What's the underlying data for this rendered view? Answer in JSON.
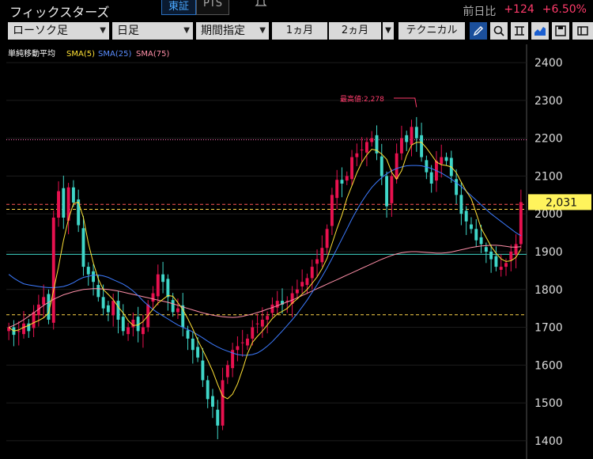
{
  "header": {
    "title": "フィックスターズ",
    "market_tabs": [
      "東証",
      "PTS"
    ],
    "change_label": "前日比",
    "change_value": "+124",
    "change_pct": "+6.50%"
  },
  "toolbar": {
    "chart_type": "ローソク足",
    "period": "日足",
    "range_mode": "期間指定",
    "range_1": "1ヵ月",
    "range_2": "2ヵ月",
    "technical": "テクニカル"
  },
  "colors": {
    "up": "#e8114f",
    "down": "#3fd6c8",
    "sma5": "#ffe135",
    "sma25": "#3d7bff",
    "sma75": "#ff8fa8",
    "price_label_bg": "#fff35c"
  },
  "chart_data": {
    "type": "candlestick",
    "indicator_label": "単純移動平均",
    "legend": [
      "SMA(5)",
      "SMA(25)",
      "SMA(75)"
    ],
    "y_ticks": [
      "2400",
      "2300",
      "2200",
      "2100",
      "2000",
      "1900",
      "1800",
      "1700",
      "1600",
      "1500",
      "1400"
    ],
    "ylim": [
      1360,
      2440
    ],
    "current_price": 2031,
    "current_price_label": "2,031",
    "annotation": "最高値:2,278",
    "annotation_value": 2278,
    "hlines": [
      {
        "value": 2196,
        "color": "#ff69b4",
        "style": "dotted"
      },
      {
        "value": 2025,
        "color": "#ff5555",
        "style": "dashed"
      },
      {
        "value": 2012,
        "color": "#ffd54a",
        "style": "dashed"
      },
      {
        "value": 1893,
        "color": "#3fd6c8",
        "style": "solid"
      },
      {
        "value": 1733,
        "color": "#ffd54a",
        "style": "dashed"
      }
    ],
    "close": [
      1700,
      1680,
      1690,
      1710,
      1690,
      1740,
      1760,
      1780,
      1720,
      1990,
      2060,
      1990,
      2070,
      2030,
      1970,
      1860,
      1840,
      1820,
      1780,
      1750,
      1740,
      1770,
      1720,
      1690,
      1700,
      1720,
      1690,
      1700,
      1760,
      1790,
      1840,
      1820,
      1780,
      1740,
      1750,
      1700,
      1670,
      1640,
      1620,
      1560,
      1510,
      1490,
      1440,
      1560,
      1600,
      1640,
      1650,
      1660,
      1670,
      1700,
      1710,
      1720,
      1730,
      1760,
      1770,
      1760,
      1770,
      1790,
      1800,
      1820,
      1830,
      1860,
      1880,
      1910,
      1960,
      2050,
      2090,
      2080,
      2100,
      2150,
      2160,
      2170,
      2190,
      2200,
      2160,
      2100,
      2020,
      2100,
      2160,
      2200,
      2190,
      2230,
      2200,
      2150,
      2110,
      2080,
      2140,
      2150,
      2140,
      2100,
      2050,
      2000,
      1980,
      1960,
      1930,
      1920,
      1900,
      1880,
      1860,
      1860,
      1870,
      1900,
      1920,
      2031
    ],
    "sma5": [
      1700,
      1690,
      1693,
      1700,
      1705,
      1712,
      1718,
      1725,
      1738,
      1797,
      1860,
      1930,
      1986,
      2027,
      2031,
      1990,
      1922,
      1870,
      1828,
      1800,
      1787,
      1773,
      1754,
      1738,
      1718,
      1705,
      1706,
      1715,
      1731,
      1748,
      1764,
      1774,
      1784,
      1782,
      1765,
      1747,
      1723,
      1696,
      1666,
      1640,
      1613,
      1584,
      1549,
      1518,
      1511,
      1523,
      1550,
      1588,
      1630,
      1660,
      1676,
      1690,
      1706,
      1723,
      1735,
      1742,
      1750,
      1764,
      1775,
      1788,
      1800,
      1816,
      1833,
      1855,
      1882,
      1921,
      1961,
      1997,
      2041,
      2074,
      2108,
      2136,
      2156,
      2171,
      2168,
      2158,
      2144,
      2110,
      2092,
      2114,
      2154,
      2182,
      2189,
      2189,
      2174,
      2156,
      2137,
      2130,
      2128,
      2124,
      2109,
      2084,
      2060,
      2040,
      2002,
      1962,
      1938,
      1914,
      1896,
      1881,
      1874,
      1876,
      1885,
      1907
    ],
    "sma25": [
      1840,
      1830,
      1822,
      1815,
      1812,
      1810,
      1808,
      1806,
      1805,
      1805,
      1806,
      1808,
      1812,
      1818,
      1826,
      1832,
      1835,
      1838,
      1838,
      1836,
      1832,
      1826,
      1820,
      1814,
      1806,
      1796,
      1784,
      1770,
      1758,
      1747,
      1738,
      1730,
      1722,
      1714,
      1706,
      1700,
      1694,
      1688,
      1680,
      1672,
      1663,
      1655,
      1648,
      1642,
      1637,
      1632,
      1628,
      1626,
      1626,
      1628,
      1632,
      1640,
      1650,
      1662,
      1676,
      1690,
      1705,
      1720,
      1736,
      1754,
      1772,
      1792,
      1812,
      1834,
      1857,
      1882,
      1908,
      1934,
      1960,
      1986,
      2010,
      2032,
      2052,
      2070,
      2084,
      2096,
      2106,
      2114,
      2120,
      2124,
      2127,
      2128,
      2128,
      2127,
      2124,
      2120,
      2114,
      2108,
      2100,
      2092,
      2082,
      2072,
      2060,
      2048,
      2036,
      2024,
      2012,
      2000,
      1990,
      1980,
      1970,
      1960,
      1950,
      1942
    ],
    "sma75": [
      1700,
      1705,
      1712,
      1720,
      1729,
      1738,
      1748,
      1758,
      1766,
      1774,
      1780,
      1786,
      1790,
      1794,
      1797,
      1800,
      1801,
      1802,
      1802,
      1801,
      1800,
      1798,
      1796,
      1793,
      1790,
      1787,
      1784,
      1781,
      1778,
      1775,
      1772,
      1769,
      1766,
      1762,
      1758,
      1754,
      1750,
      1746,
      1742,
      1738,
      1735,
      1732,
      1730,
      1728,
      1727,
      1726,
      1727,
      1729,
      1732,
      1735,
      1739,
      1743,
      1748,
      1752,
      1757,
      1762,
      1767,
      1772,
      1778,
      1784,
      1790,
      1796,
      1802,
      1808,
      1814,
      1820,
      1826,
      1832,
      1838,
      1844,
      1850,
      1856,
      1862,
      1868,
      1874,
      1880,
      1885,
      1890,
      1894,
      1897,
      1899,
      1900,
      1900,
      1899,
      1898,
      1897,
      1896,
      1896,
      1897,
      1899,
      1902,
      1905,
      1908,
      1911,
      1913,
      1915,
      1916,
      1917,
      1917,
      1916,
      1914,
      1912,
      1912,
      1913
    ]
  }
}
